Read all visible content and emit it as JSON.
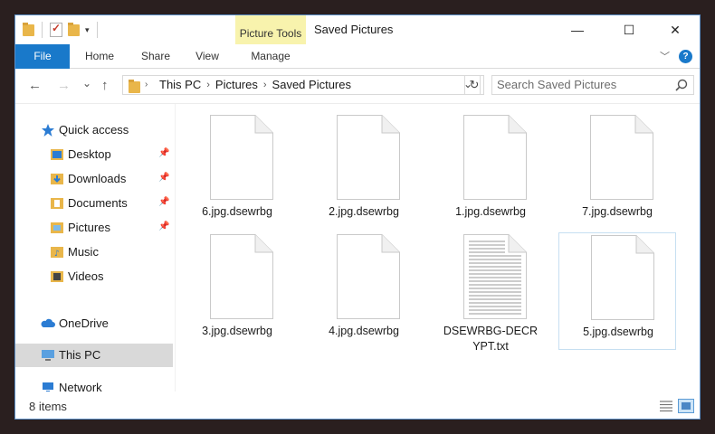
{
  "window": {
    "title": "Saved Pictures",
    "context_tab_group": "Picture Tools",
    "controls": {
      "minimize": "—",
      "maximize": "☐",
      "close": "✕"
    }
  },
  "quick_access_toolbar": {
    "dropdown": "▾"
  },
  "ribbon": {
    "tabs": [
      {
        "label": "File"
      },
      {
        "label": "Home"
      },
      {
        "label": "Share"
      },
      {
        "label": "View"
      },
      {
        "label": "Manage"
      }
    ],
    "expand_icon": "chevron-down-icon",
    "help_label": "?"
  },
  "navigation": {
    "back": "←",
    "forward": "→",
    "recent": "⌄",
    "up": "↑",
    "breadcrumb": [
      "This PC",
      "Pictures",
      "Saved Pictures"
    ],
    "separator": "›",
    "address_dropdown": "⌄",
    "refresh": "↻"
  },
  "search": {
    "placeholder": "Search Saved Pictures",
    "icon": "search-icon"
  },
  "nav_pane": {
    "quick_access": "Quick access",
    "items": [
      {
        "label": "Desktop",
        "pinned": true,
        "icon": "desktop-icon"
      },
      {
        "label": "Downloads",
        "pinned": true,
        "icon": "downloads-icon"
      },
      {
        "label": "Documents",
        "pinned": true,
        "icon": "documents-icon"
      },
      {
        "label": "Pictures",
        "pinned": true,
        "icon": "pictures-icon"
      },
      {
        "label": "Music",
        "pinned": false,
        "icon": "music-icon"
      },
      {
        "label": "Videos",
        "pinned": false,
        "icon": "videos-icon"
      }
    ],
    "onedrive": "OneDrive",
    "this_pc": "This PC",
    "network": "Network"
  },
  "files": [
    {
      "name": "6.jpg.dsewrbg",
      "type": "blank"
    },
    {
      "name": "2.jpg.dsewrbg",
      "type": "blank"
    },
    {
      "name": "1.jpg.dsewrbg",
      "type": "blank"
    },
    {
      "name": "7.jpg.dsewrbg",
      "type": "blank"
    },
    {
      "name": "3.jpg.dsewrbg",
      "type": "blank"
    },
    {
      "name": "4.jpg.dsewrbg",
      "type": "blank"
    },
    {
      "name": "DSEWRBG-DECRYPT.txt",
      "name_line1": "DSEWRBG-DECR",
      "name_line2": "YPT.txt",
      "type": "text"
    },
    {
      "name": "5.jpg.dsewrbg",
      "type": "blank"
    }
  ],
  "status": {
    "item_count": "8 items"
  },
  "colors": {
    "accent": "#1979ca",
    "context_tab": "#f8f3ad",
    "folder": "#e9b64a"
  }
}
